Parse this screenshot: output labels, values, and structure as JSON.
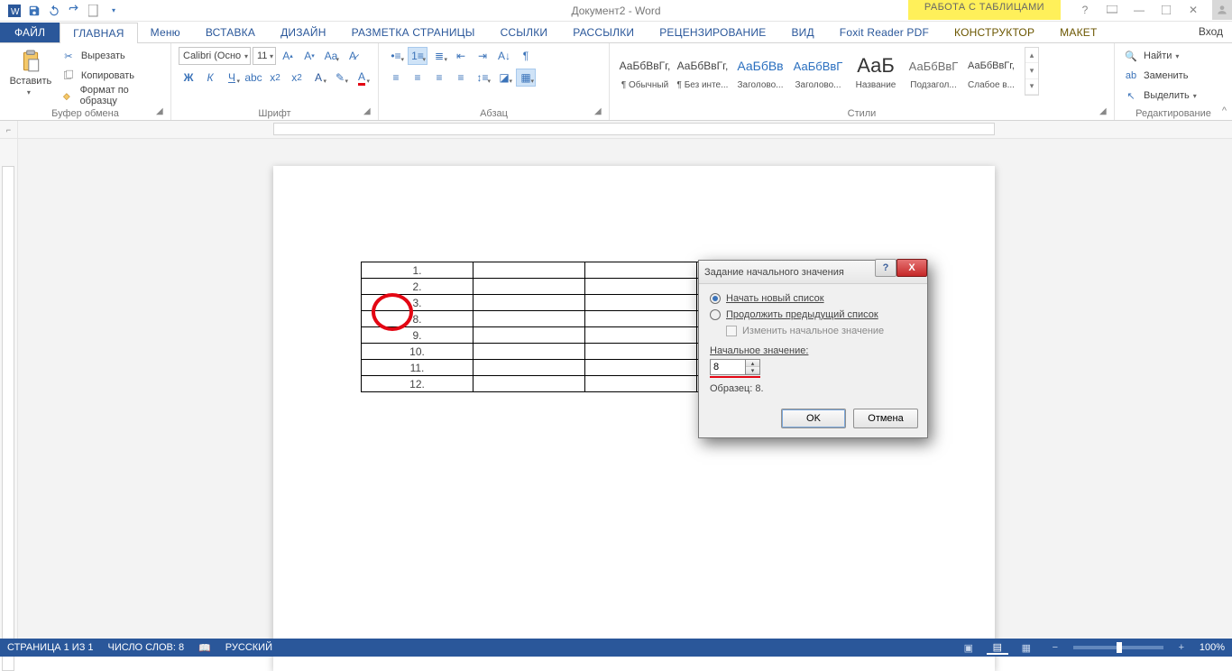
{
  "title": "Документ2 - Word",
  "tools_tab": "РАБОТА С ТАБЛИЦАМИ",
  "signin": "Вход",
  "tabs": {
    "file": "ФАЙЛ",
    "home": "ГЛАВНАЯ",
    "menu": "Меню",
    "insert": "ВСТАВКА",
    "design": "ДИЗАЙН",
    "layout": "РАЗМЕТКА СТРАНИЦЫ",
    "references": "ССЫЛКИ",
    "mailings": "РАССЫЛКИ",
    "review": "РЕЦЕНЗИРОВАНИЕ",
    "view": "ВИД",
    "foxit": "Foxit Reader PDF",
    "tdesign": "КОНСТРУКТОР",
    "tlayout": "МАКЕТ"
  },
  "clipboard": {
    "paste": "Вставить",
    "cut": "Вырезать",
    "copy": "Копировать",
    "painter": "Формат по образцу",
    "group": "Буфер обмена"
  },
  "font": {
    "name": "Calibri (Осно",
    "size": "11",
    "group": "Шрифт"
  },
  "para": {
    "group": "Абзац"
  },
  "styles": {
    "group": "Стили",
    "items": [
      {
        "prev": "АаБбВвГг,",
        "name": "¶ Обычный"
      },
      {
        "prev": "АаБбВвГг,",
        "name": "¶ Без инте..."
      },
      {
        "prev": "АаБбВв",
        "name": "Заголово..."
      },
      {
        "prev": "АаБбВвГ",
        "name": "Заголово..."
      },
      {
        "prev": "АаБ",
        "name": "Название"
      },
      {
        "prev": "АаБбВвГ",
        "name": "Подзагол..."
      },
      {
        "prev": "АаБбВвГг,",
        "name": "Слабое в..."
      }
    ]
  },
  "editing": {
    "find": "Найти",
    "replace": "Заменить",
    "select": "Выделить",
    "group": "Редактирование"
  },
  "doc_numbers": [
    "1.",
    "2.",
    "3.",
    "8.",
    "9.",
    "10.",
    "11.",
    "12."
  ],
  "dialog": {
    "title": "Задание начального значения",
    "opt_new": "Начать новый список",
    "opt_continue": "Продолжить предыдущий список",
    "chk_change": "Изменить начальное значение",
    "label_start": "Начальное значение:",
    "value": "8",
    "sample": "Образец: 8.",
    "ok": "OK",
    "cancel": "Отмена"
  },
  "status": {
    "page": "СТРАНИЦА 1 ИЗ 1",
    "words": "ЧИСЛО СЛОВ: 8",
    "lang": "РУССКИЙ",
    "zoom": "100%"
  }
}
